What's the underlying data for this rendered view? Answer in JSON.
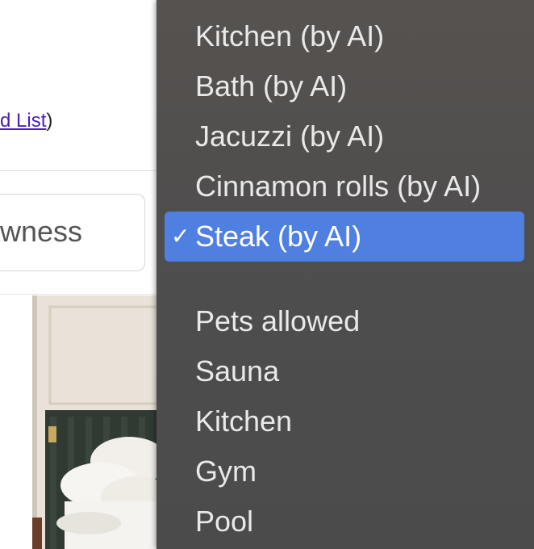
{
  "page": {
    "link_text": "d List",
    "link_suffix": ")",
    "input_value": "wness"
  },
  "menu": {
    "ai_items": [
      {
        "label": "Kitchen (by AI)",
        "selected": false
      },
      {
        "label": "Bath (by AI)",
        "selected": false
      },
      {
        "label": "Jacuzzi (by AI)",
        "selected": false
      },
      {
        "label": "Cinnamon rolls (by AI)",
        "selected": false
      },
      {
        "label": "Steak (by AI)",
        "selected": true
      }
    ],
    "checkmark": "✓",
    "items": [
      {
        "label": "Pets allowed"
      },
      {
        "label": "Sauna"
      },
      {
        "label": "Kitchen"
      },
      {
        "label": "Gym"
      },
      {
        "label": "Pool"
      }
    ]
  }
}
